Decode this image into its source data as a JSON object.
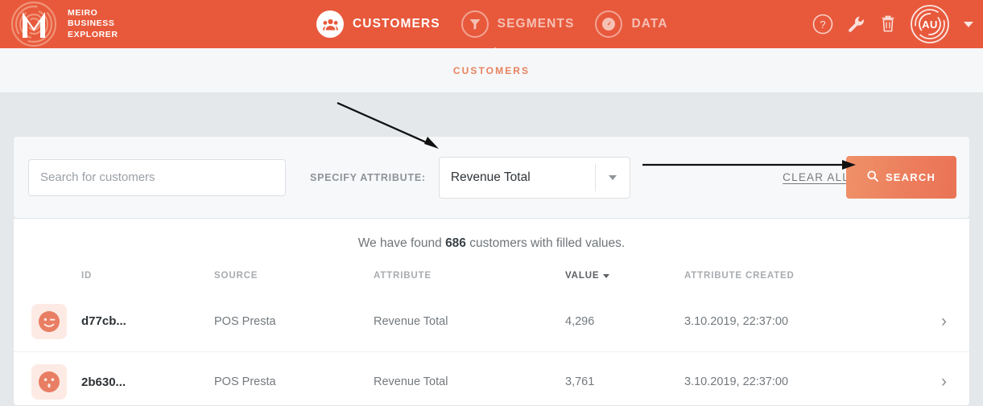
{
  "brand": {
    "line1": "MEIRO",
    "line2": "BUSINESS",
    "line3": "EXPLORER",
    "logo_icon": "meiro-maze-logo-icon"
  },
  "colors": {
    "header_bg": "#e8593c",
    "accent": "#ea7355",
    "page_bg": "#e4e8ea",
    "card_bg": "#f7f8f9",
    "avatar_bg": "#fdeae4",
    "avatar_face": "#e87e63"
  },
  "nav": {
    "items": [
      {
        "label": "Customers",
        "icon": "people-icon",
        "active": true
      },
      {
        "label": "Segments",
        "icon": "funnel-icon",
        "active": false
      },
      {
        "label": "Data",
        "icon": "gauge-icon",
        "active": false
      }
    ]
  },
  "topicons": {
    "help": "help-circle-icon",
    "tools": "wrench-icon",
    "trash": "trash-icon",
    "avatar_initials": "AU",
    "caret": "chevron-down-icon"
  },
  "subheader": {
    "title": "CUSTOMERS"
  },
  "search": {
    "placeholder": "Search for customers",
    "value": "",
    "attribute_label": "SPECIFY ATTRIBUTE:",
    "attribute_value": "Revenue Total",
    "clear_all_label": "CLEAR ALL",
    "search_button_label": "SEARCH",
    "search_icon": "magnifier-icon"
  },
  "results": {
    "found_prefix": "We have found ",
    "found_count": "686",
    "found_suffix": " customers with filled values.",
    "columns": [
      {
        "key": "id",
        "label": "ID",
        "sorted": false
      },
      {
        "key": "source",
        "label": "SOURCE",
        "sorted": false
      },
      {
        "key": "attribute",
        "label": "ATTRIBUTE",
        "sorted": false
      },
      {
        "key": "value",
        "label": "VALUE",
        "sorted": true
      },
      {
        "key": "created",
        "label": "ATTRIBUTE CREATED",
        "sorted": false
      }
    ],
    "rows": [
      {
        "avatar": "winking-face-icon",
        "id": "d77cb...",
        "source": "POS Presta",
        "attribute": "Revenue Total",
        "value": "4,296",
        "created": "3.10.2019, 22:37:00",
        "chevron": "chevron-right-icon"
      },
      {
        "avatar": "surprised-face-icon",
        "id": "2b630...",
        "source": "POS Presta",
        "attribute": "Revenue Total",
        "value": "3,761",
        "created": "3.10.2019, 22:37:00",
        "chevron": "chevron-right-icon"
      }
    ]
  },
  "annotations": {
    "arrow1": "arrow-to-attribute-dropdown",
    "arrow2": "arrow-to-search-button"
  }
}
